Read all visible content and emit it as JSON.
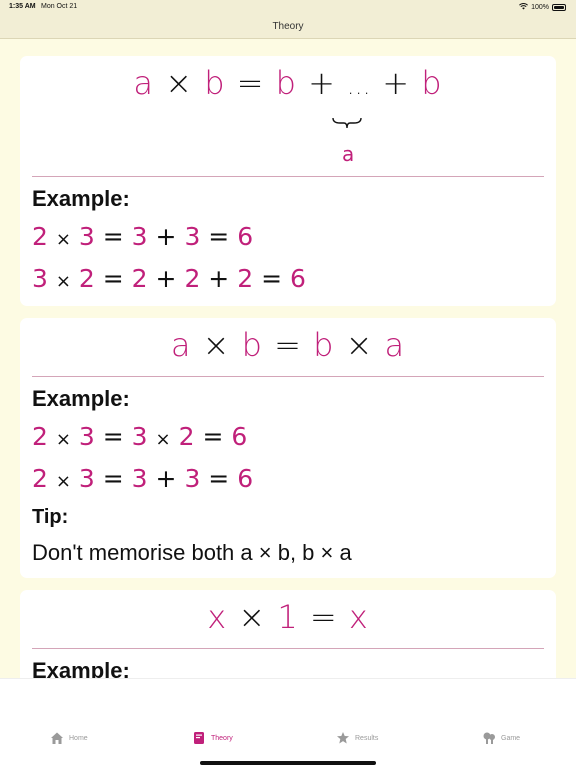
{
  "status": {
    "time": "1:35 AM",
    "date": "Mon Oct 21",
    "battery": "100%"
  },
  "nav": {
    "title": "Theory"
  },
  "cards": [
    {
      "formula": [
        "a",
        "×",
        "b",
        "=",
        "b",
        "+",
        "...",
        "+",
        "b"
      ],
      "brace_label": "a",
      "example_label": "Example:",
      "examples": [
        [
          "2",
          "×",
          "3",
          "=",
          "3",
          "+",
          "3",
          "=",
          "6"
        ],
        [
          "3",
          "×",
          "2",
          "=",
          "2",
          "+",
          "2",
          "+",
          "2",
          "=",
          "6"
        ]
      ]
    },
    {
      "formula": [
        "a",
        "×",
        "b",
        "=",
        "b",
        "×",
        "a"
      ],
      "example_label": "Example:",
      "examples": [
        [
          "2",
          "×",
          "3",
          "=",
          "3",
          "×",
          "2",
          "=",
          "6"
        ],
        [
          "2",
          "×",
          "3",
          "=",
          "3",
          "+",
          "3",
          "=",
          "6"
        ]
      ],
      "tip_label": "Tip:",
      "tip_text": "Don't memorise both a × b, b × a"
    },
    {
      "formula": [
        "x",
        "×",
        "1",
        "=",
        "x"
      ],
      "example_label": "Example:"
    }
  ],
  "tabs": [
    {
      "label": "Home",
      "icon": "house-icon",
      "active": false
    },
    {
      "label": "Theory",
      "icon": "book-icon",
      "active": true
    },
    {
      "label": "Results",
      "icon": "star-icon",
      "active": false
    },
    {
      "label": "Game",
      "icon": "game-icon",
      "active": false
    }
  ],
  "colors": {
    "accent": "#c0207a",
    "background": "#fdfbe3",
    "tab_inactive": "#9a9a9a"
  }
}
